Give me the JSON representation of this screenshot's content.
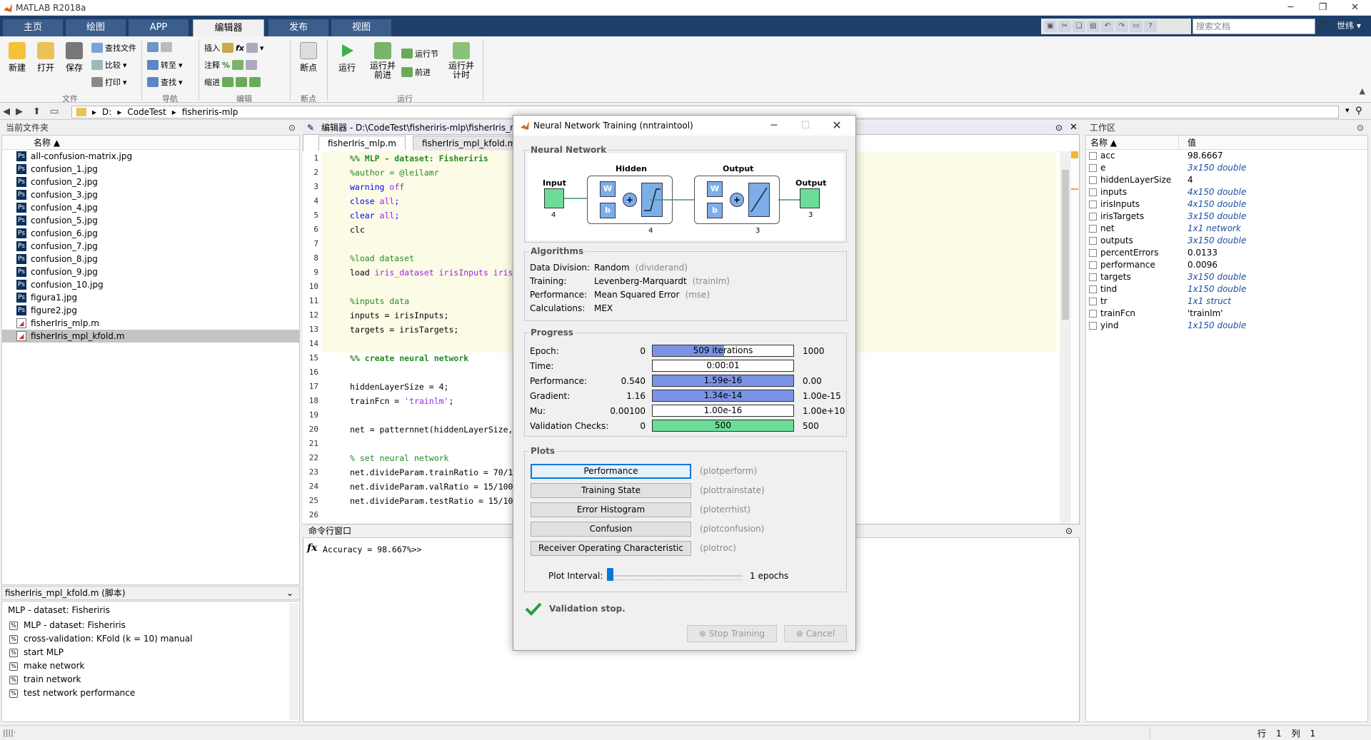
{
  "app": {
    "title": "MATLAB R2018a"
  },
  "ribbon_tabs": [
    "主页",
    "绘图",
    "APP",
    "编辑器",
    "发布",
    "视图"
  ],
  "search_doc": {
    "placeholder": "搜索文档"
  },
  "user": "世纬",
  "ribbon": {
    "new": "新建",
    "open": "打开",
    "save": "保存",
    "find_files": "查找文件",
    "compare": "比较",
    "print": "打印",
    "goto": "转至",
    "find": "查找",
    "insert": "插入",
    "comment": "注释",
    "indent": "缩进",
    "breakpoints": "断点",
    "run": "运行",
    "run_advance": "运行并\n前进",
    "run_section": "运行节",
    "advance": "前进",
    "run_time": "运行并\n计时",
    "groups": {
      "file": "文件",
      "nav": "导航",
      "edit": "编辑",
      "bp": "断点",
      "run": "运行"
    }
  },
  "path": {
    "drive": "D:",
    "folders": [
      "CodeTest",
      "fisheriris-mlp"
    ]
  },
  "files_panel": {
    "title": "当前文件夹",
    "col_name": "名称 ▲",
    "items": [
      {
        "name": "all-confusion-matrix.jpg",
        "type": "img"
      },
      {
        "name": "confusion_1.jpg",
        "type": "img"
      },
      {
        "name": "confusion_2.jpg",
        "type": "img"
      },
      {
        "name": "confusion_3.jpg",
        "type": "img"
      },
      {
        "name": "confusion_4.jpg",
        "type": "img"
      },
      {
        "name": "confusion_5.jpg",
        "type": "img"
      },
      {
        "name": "confusion_6.jpg",
        "type": "img"
      },
      {
        "name": "confusion_7.jpg",
        "type": "img"
      },
      {
        "name": "confusion_8.jpg",
        "type": "img"
      },
      {
        "name": "confusion_9.jpg",
        "type": "img"
      },
      {
        "name": "confusion_10.jpg",
        "type": "img"
      },
      {
        "name": "figura1.jpg",
        "type": "img"
      },
      {
        "name": "figure2.jpg",
        "type": "img"
      },
      {
        "name": "fisherIris_mlp.m",
        "type": "m"
      },
      {
        "name": "fisherIris_mpl_kfold.m",
        "type": "m",
        "selected": true
      }
    ]
  },
  "details": {
    "header": "fisherIris_mpl_kfold.m  (脚本)",
    "title": "MLP - dataset: Fisheriris",
    "items": [
      "MLP - dataset: Fisheriris",
      "cross-validation: KFold (k = 10) manual",
      "start MLP",
      "make network",
      "train network",
      "test network performance"
    ]
  },
  "editor": {
    "title": "编辑器 - D:\\CodeTest\\fisheriris-mlp\\fisherIris_m",
    "tabs": [
      "fisherIris_mlp.m",
      "fisherIris_mpl_kfold.m"
    ],
    "lines": [
      {
        "n": "1",
        "t": "%% MLP - dataset: Fisheriris",
        "c": "cmt-b"
      },
      {
        "n": "2",
        "t": "%author = @leilamr",
        "c": "cmt"
      },
      {
        "n": "3",
        "t": "warning off",
        "c": "kw2"
      },
      {
        "n": "4",
        "t": "close all;",
        "c": "kw2"
      },
      {
        "n": "5",
        "t": "clear all;",
        "c": "kw2"
      },
      {
        "n": "6",
        "t": "clc",
        "c": ""
      },
      {
        "n": "7",
        "t": "",
        "c": ""
      },
      {
        "n": "8",
        "t": "%load dataset",
        "c": "cmt"
      },
      {
        "n": "9",
        "t": "load iris_dataset irisInputs iris",
        "c": "load"
      },
      {
        "n": "10",
        "t": "",
        "c": ""
      },
      {
        "n": "11",
        "t": "%inputs data",
        "c": "cmt"
      },
      {
        "n": "12",
        "t": "inputs = irisInputs;",
        "c": ""
      },
      {
        "n": "13",
        "t": "targets = irisTargets;",
        "c": ""
      },
      {
        "n": "14",
        "t": "",
        "c": ""
      },
      {
        "n": "15",
        "t": "%% create neural network",
        "c": "cmt-b"
      },
      {
        "n": "16",
        "t": "",
        "c": ""
      },
      {
        "n": "17",
        "t": "hiddenLayerSize = 4;",
        "c": ""
      },
      {
        "n": "18",
        "t": "trainFcn = 'trainlm';",
        "c": "str"
      },
      {
        "n": "19",
        "t": "",
        "c": ""
      },
      {
        "n": "20",
        "t": "net = patternnet(hiddenLayerSize,",
        "c": ""
      },
      {
        "n": "21",
        "t": "",
        "c": ""
      },
      {
        "n": "22",
        "t": "% set neural network",
        "c": "cmt"
      },
      {
        "n": "23",
        "t": "net.divideParam.trainRatio = 70/1",
        "c": ""
      },
      {
        "n": "24",
        "t": "net.divideParam.valRatio = 15/100",
        "c": ""
      },
      {
        "n": "25",
        "t": "net.divideParam.testRatio = 15/10",
        "c": ""
      },
      {
        "n": "26",
        "t": "",
        "c": ""
      }
    ]
  },
  "command_window": {
    "title": "命令行窗口",
    "output": "Accuracy = 98.667%>>"
  },
  "workspace": {
    "title": "工作区",
    "col_name": "名称 ▲",
    "col_value": "值",
    "vars": [
      {
        "name": "acc",
        "value": "98.6667",
        "italic": false
      },
      {
        "name": "e",
        "value": "3x150 double",
        "italic": true
      },
      {
        "name": "hiddenLayerSize",
        "value": "4",
        "italic": false
      },
      {
        "name": "inputs",
        "value": "4x150 double",
        "italic": true
      },
      {
        "name": "irisInputs",
        "value": "4x150 double",
        "italic": true
      },
      {
        "name": "irisTargets",
        "value": "3x150 double",
        "italic": true
      },
      {
        "name": "net",
        "value": "1x1 network",
        "italic": true
      },
      {
        "name": "outputs",
        "value": "3x150 double",
        "italic": true
      },
      {
        "name": "percentErrors",
        "value": "0.0133",
        "italic": false
      },
      {
        "name": "performance",
        "value": "0.0096",
        "italic": false
      },
      {
        "name": "targets",
        "value": "3x150 double",
        "italic": true
      },
      {
        "name": "tind",
        "value": "1x150 double",
        "italic": true
      },
      {
        "name": "tr",
        "value": "1x1 struct",
        "italic": true
      },
      {
        "name": "trainFcn",
        "value": "'trainlm'",
        "italic": false
      },
      {
        "name": "yind",
        "value": "1x150 double",
        "italic": true
      }
    ]
  },
  "status": {
    "row_label": "行",
    "row": "1",
    "col_label": "列",
    "col": "1"
  },
  "dialog": {
    "title": "Neural Network Training (nntraintool)",
    "nn": {
      "section": "Neural Network",
      "input": "Input",
      "input_n": "4",
      "hidden": "Hidden",
      "hidden_n": "4",
      "output": "Output",
      "output_n": "3",
      "output_node": "Output",
      "output_node_n": "3",
      "w": "W",
      "b": "b"
    },
    "algorithms": {
      "section": "Algorithms",
      "rows": [
        {
          "label": "Data Division:",
          "value": "Random",
          "fn": "(dividerand)"
        },
        {
          "label": "Training:",
          "value": "Levenberg-Marquardt",
          "fn": "(trainlm)"
        },
        {
          "label": "Performance:",
          "value": "Mean Squared Error",
          "fn": "(mse)"
        },
        {
          "label": "Calculations:",
          "value": "MEX",
          "fn": ""
        }
      ]
    },
    "progress": {
      "section": "Progress",
      "rows": [
        {
          "label": "Epoch:",
          "min": "0",
          "text": "509 iterations",
          "max": "1000",
          "fill": 0.509,
          "color": "#7b93e6"
        },
        {
          "label": "Time:",
          "min": "",
          "text": "0:00:01",
          "max": "",
          "fill": 0,
          "color": "#7b93e6"
        },
        {
          "label": "Performance:",
          "min": "0.540",
          "text": "1.59e-16",
          "max": "0.00",
          "fill": 1,
          "color": "#7b93e6"
        },
        {
          "label": "Gradient:",
          "min": "1.16",
          "text": "1.34e-14",
          "max": "1.00e-15",
          "fill": 1,
          "color": "#7b93e6"
        },
        {
          "label": "Mu:",
          "min": "0.00100",
          "text": "1.00e-16",
          "max": "1.00e+10",
          "fill": 0,
          "color": "#7b93e6"
        },
        {
          "label": "Validation Checks:",
          "min": "0",
          "text": "500",
          "max": "500",
          "fill": 1,
          "color": "#6ddc98"
        }
      ]
    },
    "plots": {
      "section": "Plots",
      "buttons": [
        {
          "label": "Performance",
          "fn": "(plotperform)"
        },
        {
          "label": "Training State",
          "fn": "(plottrainstate)"
        },
        {
          "label": "Error Histogram",
          "fn": "(ploterrhist)"
        },
        {
          "label": "Confusion",
          "fn": "(plotconfusion)"
        },
        {
          "label": "Receiver Operating Characteristic",
          "fn": "(plotroc)"
        }
      ],
      "interval_label": "Plot Interval:",
      "interval_value": "1 epochs"
    },
    "status": "Validation stop.",
    "stop_training": "Stop Training",
    "cancel": "Cancel"
  }
}
